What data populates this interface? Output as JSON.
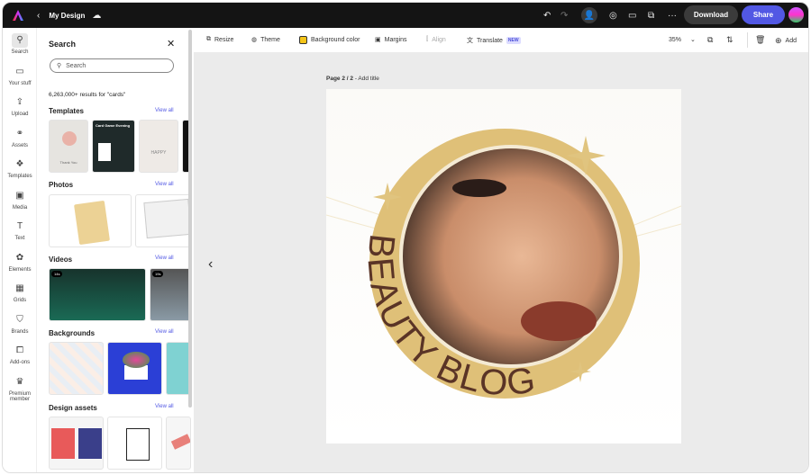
{
  "topbar": {
    "title": "My Design",
    "download": "Download",
    "share": "Share"
  },
  "rail": [
    {
      "label": "Search",
      "icon": "search-icon"
    },
    {
      "label": "Your stuff",
      "icon": "folder-icon"
    },
    {
      "label": "Upload",
      "icon": "upload-icon"
    },
    {
      "label": "Assets",
      "icon": "assets-icon"
    },
    {
      "label": "Templates",
      "icon": "templates-icon"
    },
    {
      "label": "Media",
      "icon": "media-icon"
    },
    {
      "label": "Text",
      "icon": "text-icon"
    },
    {
      "label": "Elements",
      "icon": "elements-icon"
    },
    {
      "label": "Grids",
      "icon": "grids-icon"
    },
    {
      "label": "Brands",
      "icon": "brands-icon"
    },
    {
      "label": "Add-ons",
      "icon": "addons-icon"
    },
    {
      "label": "Premium member",
      "icon": "crown-icon"
    }
  ],
  "panel": {
    "title": "Search",
    "placeholder": "Search",
    "results": "6,263,000+ results for \"cards\"",
    "view_all": "View all",
    "sections": {
      "templates": "Templates",
      "photos": "Photos",
      "videos": "Videos",
      "backgrounds": "Backgrounds",
      "design_assets": "Design assets"
    },
    "template_texts": [
      "Thank You",
      "Card Game Evening",
      "HAPPY"
    ],
    "video_durations": [
      "14s",
      "19s"
    ]
  },
  "toolbar": {
    "resize": "Resize",
    "theme": "Theme",
    "bg_color": "Background color",
    "margins": "Margins",
    "align": "Align",
    "translate": "Translate",
    "new_badge": "NEW",
    "zoom": "35%",
    "add": "Add",
    "bg_swatch": "#f5c518"
  },
  "canvas": {
    "page_label": "Page 2 / 2",
    "add_title": "- Add title",
    "design_text": "BEAUTY BLOG"
  }
}
